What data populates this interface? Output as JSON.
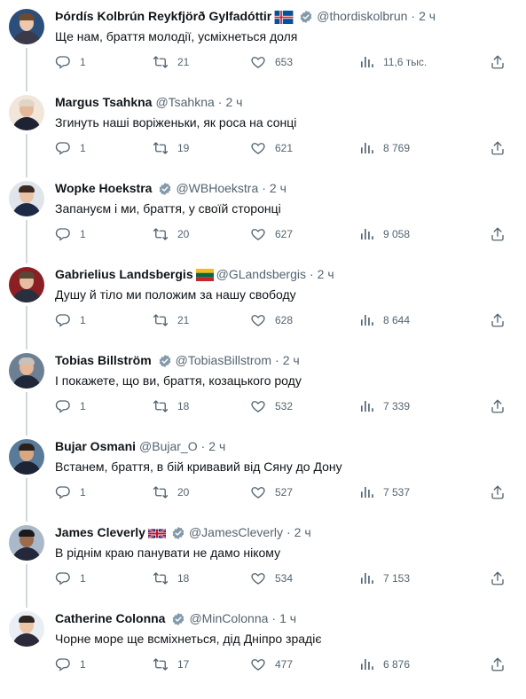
{
  "tweets": [
    {
      "name": "Þórdís Kolbrún Reykfjörð Gylfadóttir",
      "flag": "iceland",
      "verified": true,
      "handle": "@thordiskolbrun",
      "time": "2 ч",
      "text": "Ще нам, браття молодії, усміхнеться доля",
      "replies": "1",
      "retweets": "21",
      "likes": "653",
      "views": "11,6 тыс."
    },
    {
      "name": "Margus Tsahkna",
      "flag": "",
      "verified": false,
      "handle": "@Tsahkna",
      "time": "2 ч",
      "text": "Згинуть наші воріженьки, як роса на сонці",
      "replies": "1",
      "retweets": "19",
      "likes": "621",
      "views": "8 769"
    },
    {
      "name": "Wopke Hoekstra",
      "flag": "",
      "verified": true,
      "handle": "@WBHoekstra",
      "time": "2 ч",
      "text": "Запануєм і ми, браття, у своїй сторонці",
      "replies": "1",
      "retweets": "20",
      "likes": "627",
      "views": "9 058"
    },
    {
      "name": "Gabrielius Landsbergis",
      "flag": "lithuania",
      "verified": false,
      "handle": "@GLandsbergis",
      "time": "2 ч",
      "text": "Душу й тіло ми положим за нашу свободу",
      "replies": "1",
      "retweets": "21",
      "likes": "628",
      "views": "8 644"
    },
    {
      "name": "Tobias Billström",
      "flag": "",
      "verified": true,
      "handle": "@TobiasBillstrom",
      "time": "2 ч",
      "text": "І покажете, що ви, браття, козацького роду",
      "replies": "1",
      "retweets": "18",
      "likes": "532",
      "views": "7 339"
    },
    {
      "name": "Bujar Osmani",
      "flag": "",
      "verified": false,
      "handle": "@Bujar_O",
      "time": "2 ч",
      "text": "Встанем, браття, в бій кривавий від Сяну до Дону",
      "replies": "1",
      "retweets": "20",
      "likes": "527",
      "views": "7 537"
    },
    {
      "name": "James Cleverly",
      "flag": "uk",
      "verified": true,
      "handle": "@JamesCleverly",
      "time": "2 ч",
      "text": "В ріднім краю панувати не дамо нікому",
      "replies": "1",
      "retweets": "18",
      "likes": "534",
      "views": "7 153"
    },
    {
      "name": "Catherine Colonna",
      "flag": "",
      "verified": true,
      "handle": "@MinColonna",
      "time": "1 ч",
      "text": "Чорне море ще всміхнеться, дід Дніпро зрадіє",
      "replies": "1",
      "retweets": "17",
      "likes": "477",
      "views": "6 876"
    }
  ],
  "colors": {
    "text": "#0f1419",
    "muted": "#536471",
    "verified": "#829aab",
    "thread_line": "#cfd9de"
  },
  "icons": {
    "reply": "reply-icon",
    "retweet": "retweet-icon",
    "like": "heart-icon",
    "views": "views-icon",
    "share": "share-icon",
    "verified": "verified-badge-icon"
  }
}
